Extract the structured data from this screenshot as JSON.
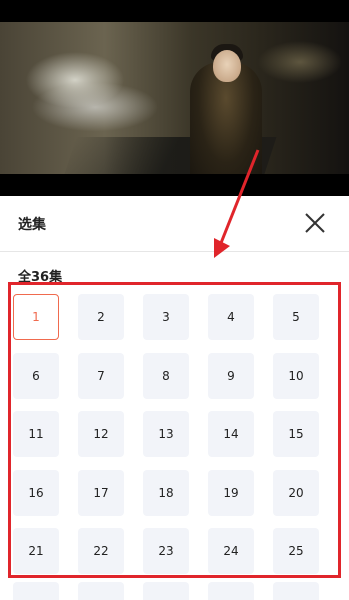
{
  "sheet": {
    "title": "选集",
    "episode_count_label": "全36集",
    "close_icon": "close-icon"
  },
  "episodes": [
    {
      "label": "1",
      "selected": true
    },
    {
      "label": "2"
    },
    {
      "label": "3"
    },
    {
      "label": "4"
    },
    {
      "label": "5"
    },
    {
      "label": "6"
    },
    {
      "label": "7"
    },
    {
      "label": "8"
    },
    {
      "label": "9"
    },
    {
      "label": "10"
    },
    {
      "label": "11"
    },
    {
      "label": "12"
    },
    {
      "label": "13"
    },
    {
      "label": "14"
    },
    {
      "label": "15"
    },
    {
      "label": "16"
    },
    {
      "label": "17"
    },
    {
      "label": "18"
    },
    {
      "label": "19"
    },
    {
      "label": "20"
    },
    {
      "label": "21"
    },
    {
      "label": "22"
    },
    {
      "label": "23"
    },
    {
      "label": "24"
    },
    {
      "label": "25"
    }
  ],
  "colors": {
    "selected_accent": "#f06a4e",
    "annotation_red": "#e0252b",
    "tile_bg": "#f2f4f9"
  }
}
